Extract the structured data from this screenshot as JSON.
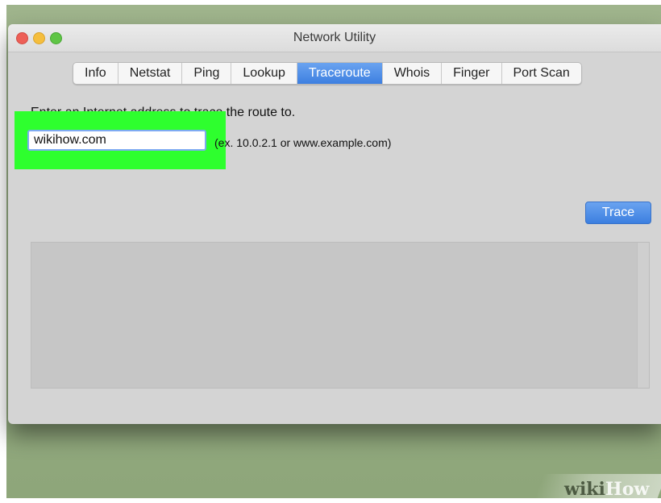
{
  "window": {
    "title": "Network Utility"
  },
  "tabs": [
    {
      "label": "Info",
      "active": false
    },
    {
      "label": "Netstat",
      "active": false
    },
    {
      "label": "Ping",
      "active": false
    },
    {
      "label": "Lookup",
      "active": false
    },
    {
      "label": "Traceroute",
      "active": true
    },
    {
      "label": "Whois",
      "active": false
    },
    {
      "label": "Finger",
      "active": false
    },
    {
      "label": "Port Scan",
      "active": false
    }
  ],
  "traceroute": {
    "instruction": "Enter an Internet address to trace the route to.",
    "address_value": "wikihow.com",
    "example_hint": "(ex. 10.0.2.1 or www.example.com)",
    "trace_button_label": "Trace"
  },
  "watermark": {
    "brand_prefix": "wiki",
    "brand_suffix": "How"
  },
  "colors": {
    "highlight": "#2eff2e",
    "accent_blue": "#3d7fe0",
    "window_background": "#d4d4d4"
  }
}
